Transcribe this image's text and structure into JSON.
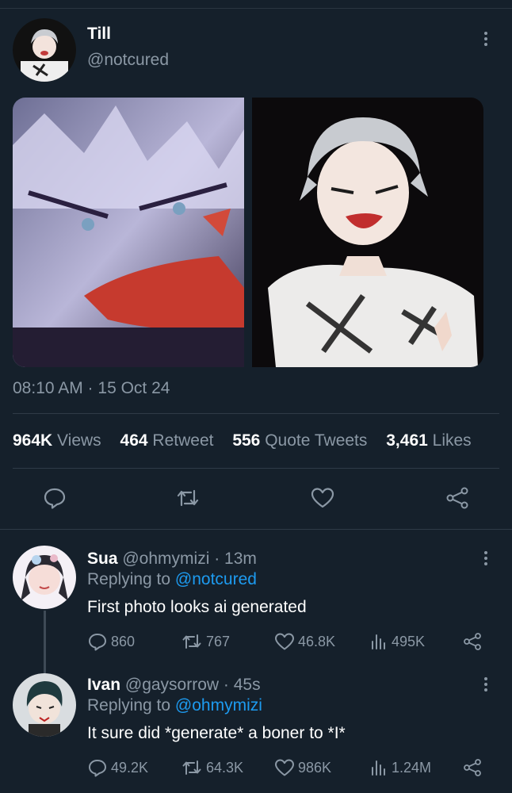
{
  "tweet": {
    "name": "Till",
    "handle": "@notcured",
    "timestamp": "08:10 AM · 15 Oct 24",
    "stats": [
      {
        "value": "964K",
        "label": "Views"
      },
      {
        "value": "464",
        "label": "Retweet"
      },
      {
        "value": "556",
        "label": "Quote Tweets"
      },
      {
        "value": "3,461",
        "label": "Likes"
      }
    ],
    "actions": [
      "reply-icon",
      "retweet-icon",
      "like-icon",
      "share-icon"
    ]
  },
  "replies": [
    {
      "name": "Sua",
      "handle": "@ohmymizi",
      "time": "· 13m",
      "replying_prefix": "Replying to",
      "replying_to": "@notcured",
      "text": "First photo looks ai generated",
      "counts": {
        "replies": "860",
        "retweets": "767",
        "likes": "46.8K",
        "views": "495K"
      }
    },
    {
      "name": "Ivan",
      "handle": "@gaysorrow",
      "time": "· 45s",
      "replying_prefix": "Replying to",
      "replying_to": "@ohmymizi",
      "text": "It sure did *generate* a boner to *I*",
      "counts": {
        "replies": "49.2K",
        "retweets": "64.3K",
        "likes": "986K",
        "views": "1.24M"
      }
    }
  ],
  "colors": {
    "background": "#15202b",
    "secondary_text": "#8b98a5",
    "link": "#1d9bf0",
    "divider": "#2f3b47"
  }
}
